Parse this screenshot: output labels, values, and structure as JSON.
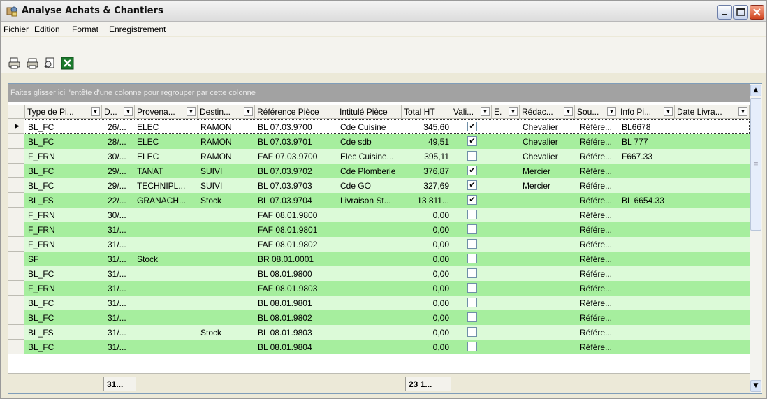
{
  "window": {
    "title": "Analyse Achats & Chantiers",
    "controls": [
      "minimize-icon",
      "maximize-icon",
      "close-icon"
    ]
  },
  "menu": [
    "Fichier",
    "Edition",
    "Format",
    "Enregistrement"
  ],
  "toolbar": {
    "buttons": [
      "open-print-icon",
      "printer-icon",
      "preview-icon",
      "excel-export-icon"
    ]
  },
  "grid": {
    "group_hint": "Faites glisser ici l'entête d'une colonne pour regrouper par cette colonne",
    "columns": [
      "Type de Pi...",
      "D...",
      "Provena...",
      "Destin...",
      "Référence Pièce",
      "Intitulé Pièce",
      "Total HT",
      "Vali...",
      "E.",
      "Rédac...",
      "Sou...",
      "Info Pi...",
      "Date Livra..."
    ],
    "rows": [
      [
        "BL_FC",
        "26/...",
        "ELEC",
        "RAMON",
        "BL 07.03.9700",
        "Cde Cuisine",
        "345,60",
        true,
        "",
        "Chevalier",
        "Référe...",
        "BL6678",
        ""
      ],
      [
        "BL_FC",
        "28/...",
        "ELEC",
        "RAMON",
        "BL 07.03.9701",
        "Cde sdb",
        "49,51",
        true,
        "",
        "Chevalier",
        "Référe...",
        "BL 777",
        ""
      ],
      [
        "F_FRN",
        "30/...",
        "ELEC",
        "RAMON",
        "FAF 07.03.9700",
        "Elec Cuisine...",
        "395,11",
        false,
        "",
        "Chevalier",
        "Référe...",
        "F667.33",
        ""
      ],
      [
        "BL_FC",
        "29/...",
        "TANAT",
        "SUIVI",
        "BL 07.03.9702",
        "Cde Plomberie",
        "376,87",
        true,
        "",
        "Mercier",
        "Référe...",
        "",
        ""
      ],
      [
        "BL_FC",
        "29/...",
        "TECHNIPL...",
        "SUIVI",
        "BL 07.03.9703",
        "Cde GO",
        "327,69",
        true,
        "",
        "Mercier",
        "Référe...",
        "",
        ""
      ],
      [
        "BL_FS",
        "22/...",
        "GRANACH...",
        "Stock",
        "BL 07.03.9704",
        "Livraison St...",
        "13 811...",
        true,
        "",
        "",
        "Référe...",
        "BL 6654.33",
        ""
      ],
      [
        "F_FRN",
        "30/...",
        "",
        "",
        "FAF 08.01.9800",
        "",
        "0,00",
        false,
        "",
        "",
        "Référe...",
        "",
        ""
      ],
      [
        "F_FRN",
        "31/...",
        "",
        "",
        "FAF 08.01.9801",
        "",
        "0,00",
        false,
        "",
        "",
        "Référe...",
        "",
        ""
      ],
      [
        "F_FRN",
        "31/...",
        "",
        "",
        "FAF 08.01.9802",
        "",
        "0,00",
        false,
        "",
        "",
        "Référe...",
        "",
        ""
      ],
      [
        "SF",
        "31/...",
        "Stock",
        "",
        "BR 08.01.0001",
        "",
        "0,00",
        false,
        "",
        "",
        "Référe...",
        "",
        ""
      ],
      [
        "BL_FC",
        "31/...",
        "",
        "",
        "BL 08.01.9800",
        "",
        "0,00",
        false,
        "",
        "",
        "Référe...",
        "",
        ""
      ],
      [
        "F_FRN",
        "31/...",
        "",
        "",
        "FAF 08.01.9803",
        "",
        "0,00",
        false,
        "",
        "",
        "Référe...",
        "",
        ""
      ],
      [
        "BL_FC",
        "31/...",
        "",
        "",
        "BL 08.01.9801",
        "",
        "0,00",
        false,
        "",
        "",
        "Référe...",
        "",
        ""
      ],
      [
        "BL_FC",
        "31/...",
        "",
        "",
        "BL 08.01.9802",
        "",
        "0,00",
        false,
        "",
        "",
        "Référe...",
        "",
        ""
      ],
      [
        "BL_FS",
        "31/...",
        "",
        "Stock",
        "BL 08.01.9803",
        "",
        "0,00",
        false,
        "",
        "",
        "Référe...",
        "",
        ""
      ],
      [
        "BL_FC",
        "31/...",
        "",
        "",
        "BL 08.01.9804",
        "",
        "0,00",
        false,
        "",
        "",
        "Référe...",
        "",
        ""
      ]
    ],
    "footer": {
      "date_summary": "31...",
      "total_summary": "23 1..."
    },
    "selected_row": 0
  },
  "colors": {
    "row_light": "#dcfad8",
    "row_dark": "#a6ee9e",
    "group_panel": "#a2a2a2"
  }
}
